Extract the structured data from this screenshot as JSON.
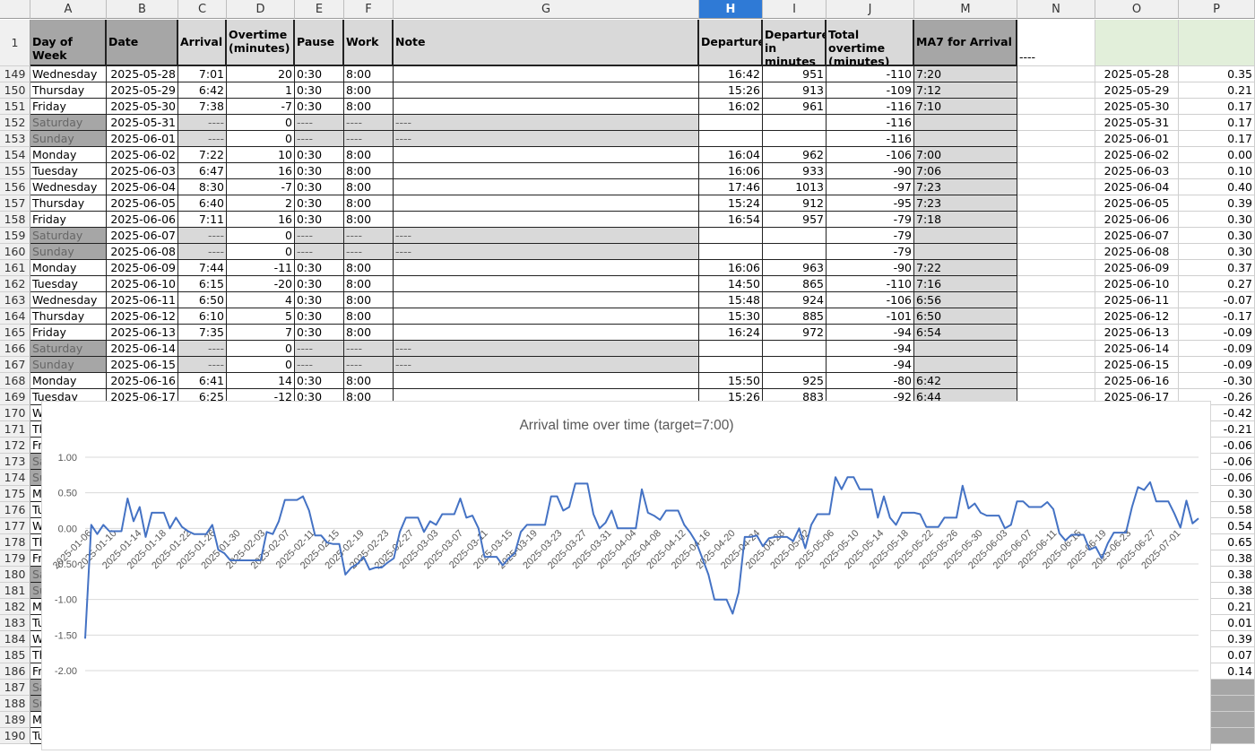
{
  "columns": [
    "A",
    "B",
    "C",
    "D",
    "E",
    "F",
    "G",
    "H",
    "I",
    "J",
    "M",
    "N",
    "O",
    "P"
  ],
  "selected_column": "H",
  "header_row": {
    "num": "1",
    "A": "Day of Week",
    "B": "Date",
    "C": "Arrival",
    "D": "Overtime (minutes)",
    "E": "Pause",
    "F": "Work",
    "G": "Note",
    "H": "Departure",
    "I": "Departure in minutes",
    "J": "Total overtime (minutes)",
    "M": "MA7 for Arrival",
    "N": "----"
  },
  "rows": [
    {
      "n": "149",
      "day": "Wednesday",
      "date": "2025-05-28",
      "arr": "7:01",
      "ot": "20",
      "pause": "0:30",
      "work": "8:00",
      "note": "",
      "dep": "16:42",
      "depm": "951",
      "tot": "-110",
      "ma": "7:20",
      "o": "2025-05-28",
      "p": "0.35",
      "we": false
    },
    {
      "n": "150",
      "day": "Thursday",
      "date": "2025-05-29",
      "arr": "6:42",
      "ot": "1",
      "pause": "0:30",
      "work": "8:00",
      "note": "",
      "dep": "15:26",
      "depm": "913",
      "tot": "-109",
      "ma": "7:12",
      "o": "2025-05-29",
      "p": "0.21",
      "we": false
    },
    {
      "n": "151",
      "day": "Friday",
      "date": "2025-05-30",
      "arr": "7:38",
      "ot": "-7",
      "pause": "0:30",
      "work": "8:00",
      "note": "",
      "dep": "16:02",
      "depm": "961",
      "tot": "-116",
      "ma": "7:10",
      "o": "2025-05-30",
      "p": "0.17",
      "we": false
    },
    {
      "n": "152",
      "day": "Saturday",
      "date": "2025-05-31",
      "arr": "----",
      "ot": "0",
      "pause": "----",
      "work": "----",
      "note": "----",
      "dep": "",
      "depm": "",
      "tot": "-116",
      "ma": "",
      "o": "2025-05-31",
      "p": "0.17",
      "we": true
    },
    {
      "n": "153",
      "day": "Sunday",
      "date": "2025-06-01",
      "arr": "----",
      "ot": "0",
      "pause": "----",
      "work": "----",
      "note": "----",
      "dep": "",
      "depm": "",
      "tot": "-116",
      "ma": "",
      "o": "2025-06-01",
      "p": "0.17",
      "we": true
    },
    {
      "n": "154",
      "day": "Monday",
      "date": "2025-06-02",
      "arr": "7:22",
      "ot": "10",
      "pause": "0:30",
      "work": "8:00",
      "note": "",
      "dep": "16:04",
      "depm": "962",
      "tot": "-106",
      "ma": "7:00",
      "o": "2025-06-02",
      "p": "0.00",
      "we": false
    },
    {
      "n": "155",
      "day": "Tuesday",
      "date": "2025-06-03",
      "arr": "6:47",
      "ot": "16",
      "pause": "0:30",
      "work": "8:00",
      "note": "",
      "dep": "16:06",
      "depm": "933",
      "tot": "-90",
      "ma": "7:06",
      "o": "2025-06-03",
      "p": "0.10",
      "we": false
    },
    {
      "n": "156",
      "day": "Wednesday",
      "date": "2025-06-04",
      "arr": "8:30",
      "ot": "-7",
      "pause": "0:30",
      "work": "8:00",
      "note": "",
      "dep": "17:46",
      "depm": "1013",
      "tot": "-97",
      "ma": "7:23",
      "o": "2025-06-04",
      "p": "0.40",
      "we": false
    },
    {
      "n": "157",
      "day": "Thursday",
      "date": "2025-06-05",
      "arr": "6:40",
      "ot": "2",
      "pause": "0:30",
      "work": "8:00",
      "note": "",
      "dep": "15:24",
      "depm": "912",
      "tot": "-95",
      "ma": "7:23",
      "o": "2025-06-05",
      "p": "0.39",
      "we": false
    },
    {
      "n": "158",
      "day": "Friday",
      "date": "2025-06-06",
      "arr": "7:11",
      "ot": "16",
      "pause": "0:30",
      "work": "8:00",
      "note": "",
      "dep": "16:54",
      "depm": "957",
      "tot": "-79",
      "ma": "7:18",
      "o": "2025-06-06",
      "p": "0.30",
      "we": false
    },
    {
      "n": "159",
      "day": "Saturday",
      "date": "2025-06-07",
      "arr": "----",
      "ot": "0",
      "pause": "----",
      "work": "----",
      "note": "----",
      "dep": "",
      "depm": "",
      "tot": "-79",
      "ma": "",
      "o": "2025-06-07",
      "p": "0.30",
      "we": true
    },
    {
      "n": "160",
      "day": "Sunday",
      "date": "2025-06-08",
      "arr": "----",
      "ot": "0",
      "pause": "----",
      "work": "----",
      "note": "----",
      "dep": "",
      "depm": "",
      "tot": "-79",
      "ma": "",
      "o": "2025-06-08",
      "p": "0.30",
      "we": true
    },
    {
      "n": "161",
      "day": "Monday",
      "date": "2025-06-09",
      "arr": "7:44",
      "ot": "-11",
      "pause": "0:30",
      "work": "8:00",
      "note": "",
      "dep": "16:06",
      "depm": "963",
      "tot": "-90",
      "ma": "7:22",
      "o": "2025-06-09",
      "p": "0.37",
      "we": false
    },
    {
      "n": "162",
      "day": "Tuesday",
      "date": "2025-06-10",
      "arr": "6:15",
      "ot": "-20",
      "pause": "0:30",
      "work": "8:00",
      "note": "",
      "dep": "14:50",
      "depm": "865",
      "tot": "-110",
      "ma": "7:16",
      "o": "2025-06-10",
      "p": "0.27",
      "we": false
    },
    {
      "n": "163",
      "day": "Wednesday",
      "date": "2025-06-11",
      "arr": "6:50",
      "ot": "4",
      "pause": "0:30",
      "work": "8:00",
      "note": "",
      "dep": "15:48",
      "depm": "924",
      "tot": "-106",
      "ma": "6:56",
      "o": "2025-06-11",
      "p": "-0.07",
      "we": false
    },
    {
      "n": "164",
      "day": "Thursday",
      "date": "2025-06-12",
      "arr": "6:10",
      "ot": "5",
      "pause": "0:30",
      "work": "8:00",
      "note": "",
      "dep": "15:30",
      "depm": "885",
      "tot": "-101",
      "ma": "6:50",
      "o": "2025-06-12",
      "p": "-0.17",
      "we": false
    },
    {
      "n": "165",
      "day": "Friday",
      "date": "2025-06-13",
      "arr": "7:35",
      "ot": "7",
      "pause": "0:30",
      "work": "8:00",
      "note": "",
      "dep": "16:24",
      "depm": "972",
      "tot": "-94",
      "ma": "6:54",
      "o": "2025-06-13",
      "p": "-0.09",
      "we": false
    },
    {
      "n": "166",
      "day": "Saturday",
      "date": "2025-06-14",
      "arr": "----",
      "ot": "0",
      "pause": "----",
      "work": "----",
      "note": "----",
      "dep": "",
      "depm": "",
      "tot": "-94",
      "ma": "",
      "o": "2025-06-14",
      "p": "-0.09",
      "we": true
    },
    {
      "n": "167",
      "day": "Sunday",
      "date": "2025-06-15",
      "arr": "----",
      "ot": "0",
      "pause": "----",
      "work": "----",
      "note": "----",
      "dep": "",
      "depm": "",
      "tot": "-94",
      "ma": "",
      "o": "2025-06-15",
      "p": "-0.09",
      "we": true
    },
    {
      "n": "168",
      "day": "Monday",
      "date": "2025-06-16",
      "arr": "6:41",
      "ot": "14",
      "pause": "0:30",
      "work": "8:00",
      "note": "",
      "dep": "15:50",
      "depm": "925",
      "tot": "-80",
      "ma": "6:42",
      "o": "2025-06-16",
      "p": "-0.30",
      "we": false
    },
    {
      "n": "169",
      "day": "Tuesday",
      "date": "2025-06-17",
      "arr": "6:25",
      "ot": "-12",
      "pause": "0:30",
      "work": "8:00",
      "note": "",
      "dep": "15:26",
      "depm": "883",
      "tot": "-92",
      "ma": "6:44",
      "o": "2025-06-17",
      "p": "-0.26",
      "we": false
    }
  ],
  "lower_rows": [
    {
      "n": "170",
      "a": "W",
      "p": "-0.42",
      "we": false
    },
    {
      "n": "171",
      "a": "Th",
      "p": "-0.21",
      "we": false
    },
    {
      "n": "172",
      "a": "Fr",
      "p": "-0.06",
      "we": false
    },
    {
      "n": "173",
      "a": "Sa",
      "p": "-0.06",
      "we": true
    },
    {
      "n": "174",
      "a": "Su",
      "p": "-0.06",
      "we": true
    },
    {
      "n": "175",
      "a": "M",
      "p": "0.30",
      "we": false
    },
    {
      "n": "176",
      "a": "Tu",
      "p": "0.58",
      "we": false
    },
    {
      "n": "177",
      "a": "W",
      "p": "0.54",
      "we": false
    },
    {
      "n": "178",
      "a": "Th",
      "p": "0.65",
      "we": false
    },
    {
      "n": "179",
      "a": "Fr",
      "p": "0.38",
      "we": false
    },
    {
      "n": "180",
      "a": "Sa",
      "p": "0.38",
      "we": true
    },
    {
      "n": "181",
      "a": "Su",
      "p": "0.38",
      "we": true
    },
    {
      "n": "182",
      "a": "M",
      "p": "0.21",
      "we": false
    },
    {
      "n": "183",
      "a": "Tu",
      "p": "0.01",
      "we": false
    },
    {
      "n": "184",
      "a": "W",
      "p": "0.39",
      "we": false
    },
    {
      "n": "185",
      "a": "Th",
      "p": "0.07",
      "we": false
    },
    {
      "n": "186",
      "a": "Fr",
      "p": "0.14",
      "we": false
    },
    {
      "n": "187",
      "a": "Sa",
      "p": "",
      "we": true
    },
    {
      "n": "188",
      "a": "Su",
      "p": "",
      "we": true
    },
    {
      "n": "189",
      "a": "M",
      "p": "",
      "we": false
    },
    {
      "n": "190",
      "a": "Tu",
      "p": "",
      "we": false
    }
  ],
  "chart_data": {
    "type": "line",
    "title": "Arrival time over time (target=7:00)",
    "ylim": [
      -2.0,
      1.0
    ],
    "yticks": [
      "1.00",
      "0.50",
      "0.00",
      "-0.50",
      "-1.00",
      "-1.50",
      "-2.00"
    ],
    "xticklabels": [
      "2025-01-06",
      "2025-01-10",
      "2025-01-14",
      "2025-01-18",
      "2025-01-22",
      "2025-01-26",
      "2025-01-30",
      "2025-02-03",
      "2025-02-07",
      "2025-02-11",
      "2025-02-15",
      "2025-02-19",
      "2025-02-23",
      "2025-02-27",
      "2025-03-03",
      "2025-03-07",
      "2025-03-11",
      "2025-03-15",
      "2025-03-19",
      "2025-03-23",
      "2025-03-27",
      "2025-03-31",
      "2025-04-04",
      "2025-04-08",
      "2025-04-12",
      "2025-04-16",
      "2025-04-20",
      "2025-04-24",
      "2025-04-28",
      "2025-05-02",
      "2025-05-06",
      "2025-05-10",
      "2025-05-14",
      "2025-05-18",
      "2025-05-22",
      "2025-05-26",
      "2025-05-30",
      "2025-06-03",
      "2025-06-07",
      "2025-06-11",
      "2025-06-15",
      "2025-06-19",
      "2025-06-23",
      "2025-06-27",
      "2025-07-01"
    ],
    "series": [
      {
        "name": "",
        "color": "#4472c4",
        "values": [
          -1.55,
          0.05,
          -0.08,
          0.05,
          -0.04,
          -0.04,
          -0.04,
          0.42,
          0.1,
          0.3,
          -0.12,
          0.22,
          0.22,
          0.22,
          0.0,
          0.15,
          0.02,
          -0.04,
          -0.08,
          -0.08,
          -0.08,
          0.05,
          -0.3,
          -0.35,
          -0.45,
          -0.45,
          -0.45,
          -0.45,
          -0.45,
          -0.45,
          -0.05,
          -0.08,
          0.1,
          0.4,
          0.4,
          0.4,
          0.45,
          0.25,
          -0.1,
          -0.1,
          -0.2,
          -0.22,
          -0.22,
          -0.65,
          -0.55,
          -0.5,
          -0.4,
          -0.58,
          -0.55,
          -0.55,
          -0.48,
          -0.42,
          -0.05,
          0.15,
          0.15,
          0.15,
          -0.05,
          0.1,
          0.05,
          0.2,
          0.2,
          0.2,
          0.42,
          0.15,
          0.18,
          0.0,
          -0.4,
          -0.4,
          -0.4,
          -0.52,
          -0.42,
          -0.35,
          -0.05,
          0.05,
          0.05,
          0.05,
          0.05,
          0.45,
          0.45,
          0.25,
          0.3,
          0.63,
          0.63,
          0.63,
          0.2,
          0.0,
          0.08,
          0.25,
          0.0,
          0.0,
          0.0,
          0.0,
          0.55,
          0.22,
          0.18,
          0.12,
          0.25,
          0.25,
          0.25,
          0.05,
          -0.06,
          -0.2,
          -0.42,
          -0.65,
          -1.0,
          -1.0,
          -1.0,
          -1.2,
          -0.9,
          -0.12,
          -0.12,
          -0.1,
          -0.25,
          -0.14,
          -0.12,
          -0.12,
          -0.12,
          -0.18,
          0.0,
          -0.28,
          0.05,
          0.2,
          0.2,
          0.2,
          0.72,
          0.55,
          0.72,
          0.72,
          0.55,
          0.55,
          0.55,
          0.15,
          0.45,
          0.15,
          0.05,
          0.22,
          0.22,
          0.22,
          0.2,
          0.02,
          0.02,
          0.02,
          0.15,
          0.15,
          0.15,
          0.6,
          0.28,
          0.35,
          0.22,
          0.18,
          0.18,
          0.18,
          0.0,
          0.05,
          0.38,
          0.38,
          0.3,
          0.3,
          0.3,
          0.37,
          0.27,
          -0.07,
          -0.17,
          -0.09,
          -0.09,
          -0.09,
          -0.3,
          -0.26,
          -0.42,
          -0.21,
          -0.06,
          -0.06,
          -0.06,
          0.3,
          0.58,
          0.54,
          0.65,
          0.38,
          0.38,
          0.38,
          0.21,
          0.01,
          0.39,
          0.07,
          0.14
        ]
      }
    ]
  }
}
